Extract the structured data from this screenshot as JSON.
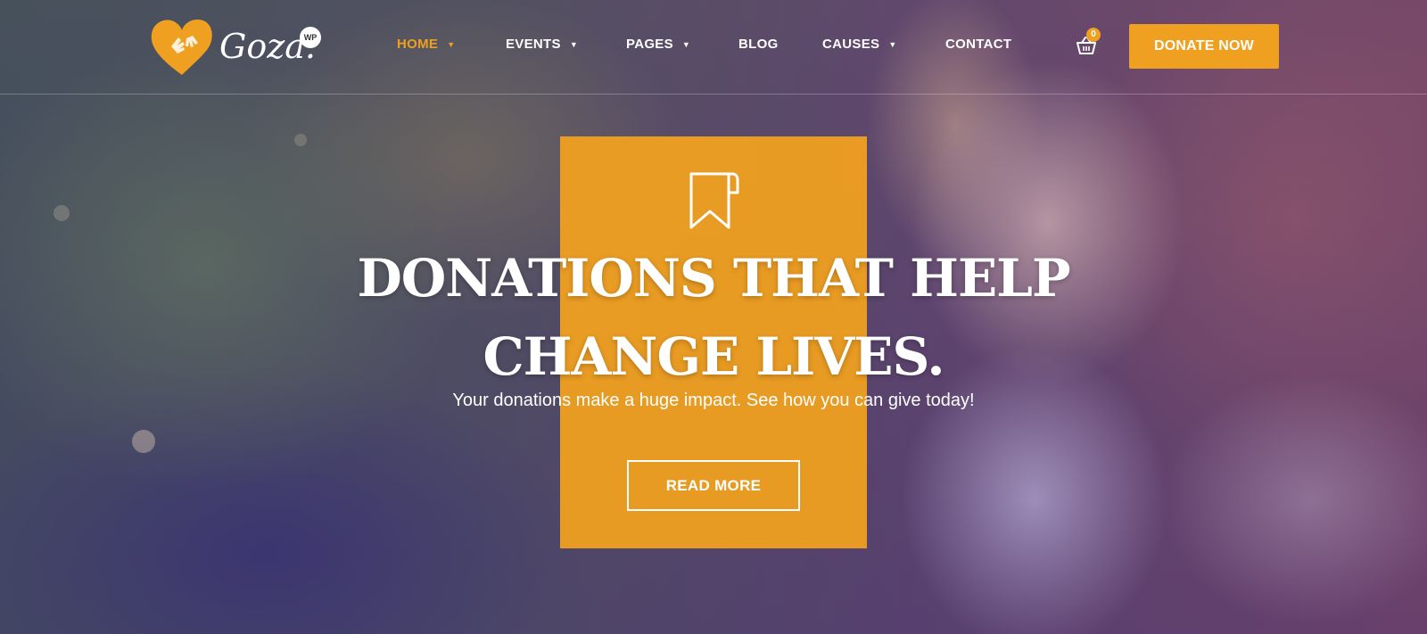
{
  "brand": {
    "logo_text": "Goza.",
    "badge": "WP",
    "accent": "#f0a020"
  },
  "nav": {
    "items": [
      {
        "label": "HOME",
        "has_dropdown": true,
        "active": true
      },
      {
        "label": "EVENTS",
        "has_dropdown": true,
        "active": false
      },
      {
        "label": "PAGES",
        "has_dropdown": true,
        "active": false
      },
      {
        "label": "BLOG",
        "has_dropdown": false,
        "active": false
      },
      {
        "label": "CAUSES",
        "has_dropdown": true,
        "active": false
      },
      {
        "label": "CONTACT",
        "has_dropdown": false,
        "active": false
      }
    ],
    "caret": "▼",
    "cart_count": "0",
    "cart_icon": "shopping-basket-icon",
    "donate_label": "DONATE NOW"
  },
  "hero": {
    "icon": "bookmark-icon",
    "headline_line1": "DONATIONS THAT HELP",
    "headline_line2": "CHANGE LIVES.",
    "subtext": "Your donations make a huge impact. See how you can give today!",
    "cta_label": "READ MORE"
  }
}
